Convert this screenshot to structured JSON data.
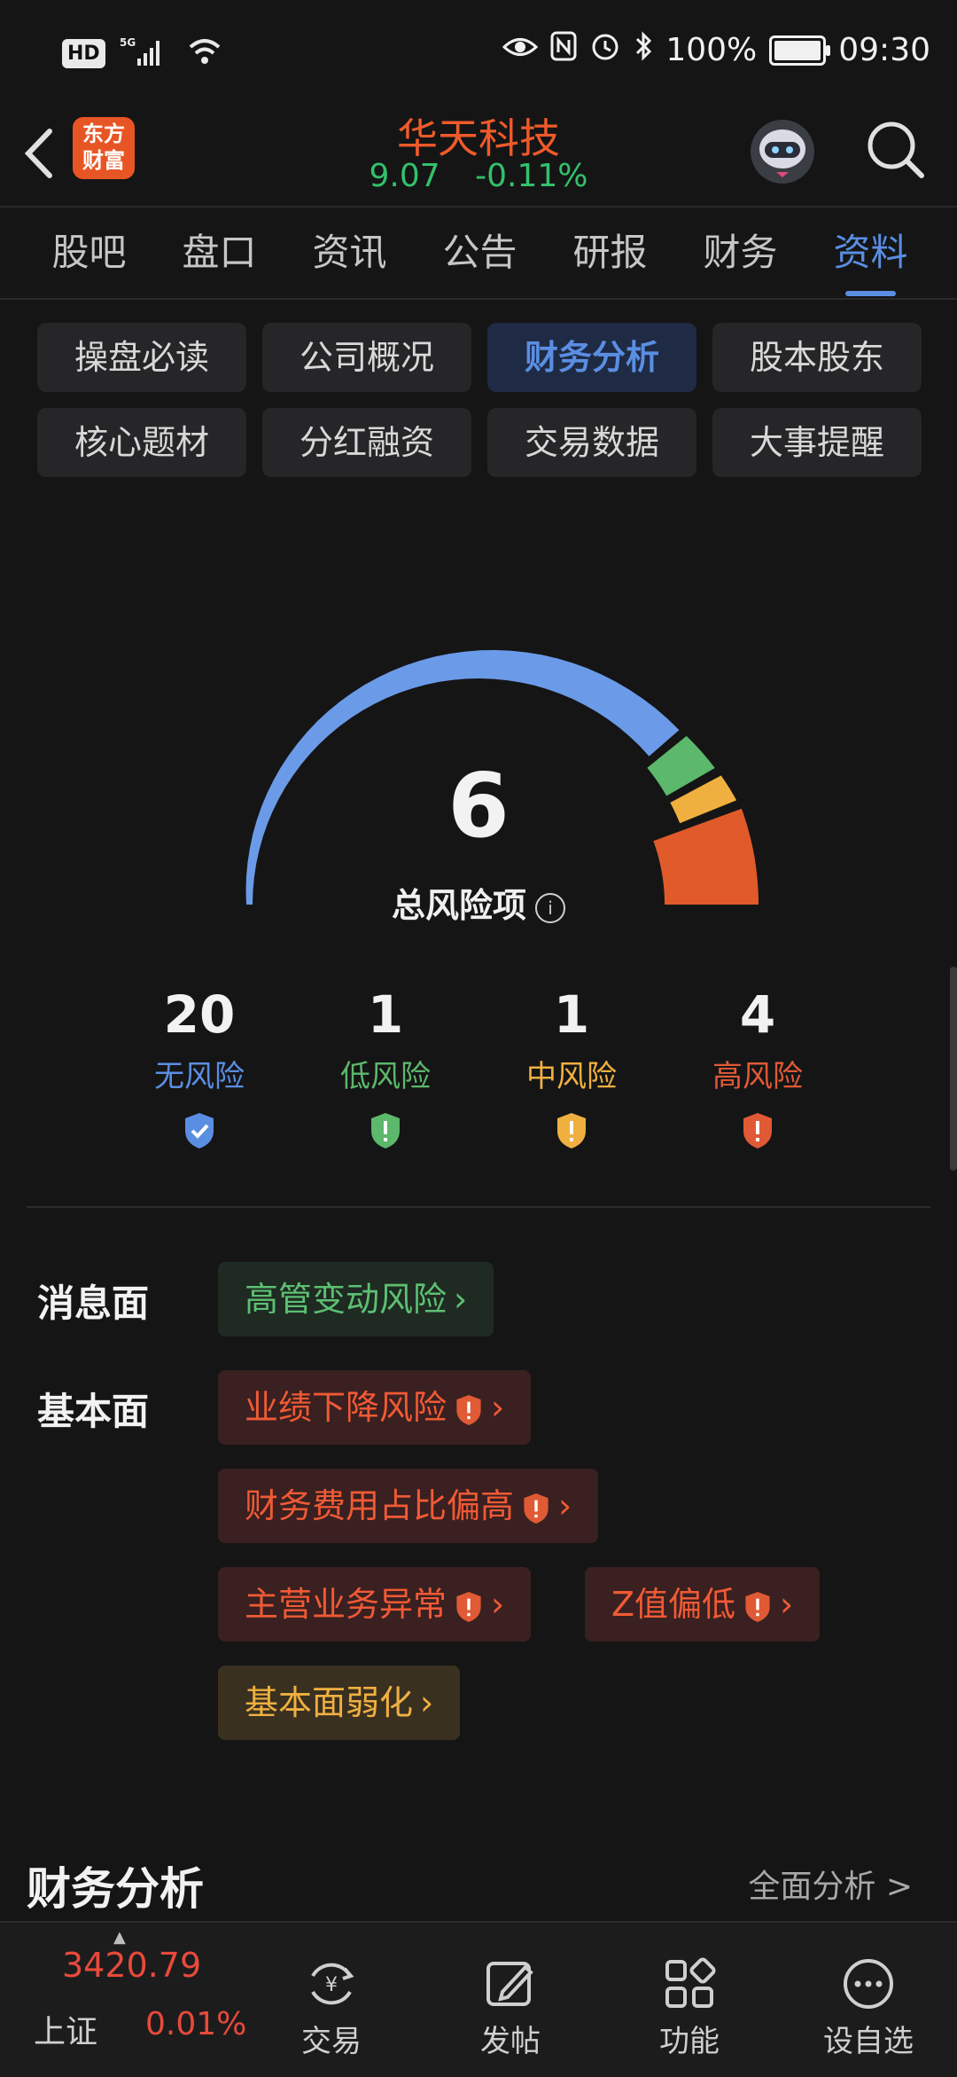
{
  "status_bar": {
    "left_icons": [
      "HD",
      "5G"
    ],
    "battery": "100%",
    "battery_level": 1.0,
    "time": "09:30"
  },
  "header": {
    "logo_text_line1": "东方",
    "logo_text_line2": "财富",
    "stock_name": "华天科技",
    "price": "9.07",
    "change_pct": "-0.11%"
  },
  "tabs": [
    {
      "label": "股吧"
    },
    {
      "label": "盘口"
    },
    {
      "label": "资讯"
    },
    {
      "label": "公告"
    },
    {
      "label": "研报"
    },
    {
      "label": "财务"
    },
    {
      "label": "资料",
      "active": true
    }
  ],
  "chips": [
    {
      "label": "操盘必读"
    },
    {
      "label": "公司概况"
    },
    {
      "label": "财务分析",
      "active": true
    },
    {
      "label": "股本股东"
    },
    {
      "label": "核心题材"
    },
    {
      "label": "分红融资"
    },
    {
      "label": "交易数据"
    },
    {
      "label": "大事提醒"
    }
  ],
  "gauge": {
    "total": "6",
    "label": "总风险项",
    "colors": {
      "none": "#6b9be8",
      "low": "#5cb86a",
      "mid": "#f0b040",
      "high": "#e05a2a"
    }
  },
  "risk_stats": [
    {
      "count": "20",
      "label": "无风险",
      "color": "#5a8ee2"
    },
    {
      "count": "1",
      "label": "低风险",
      "color": "#5cb86a"
    },
    {
      "count": "1",
      "label": "中风险",
      "color": "#f0b040"
    },
    {
      "count": "4",
      "label": "高风险",
      "color": "#e05a35"
    }
  ],
  "sections": {
    "news_label": "消息面",
    "news_tags": [
      {
        "label": "高管变动风险",
        "level": "green"
      }
    ],
    "fundamental_label": "基本面",
    "fundamental_tags": [
      {
        "label": "业绩下降风险",
        "level": "red"
      },
      {
        "label": "财务费用占比偏高",
        "level": "red"
      },
      {
        "label": "主营业务异常",
        "level": "red"
      },
      {
        "label": "Z值偏低",
        "level": "red"
      },
      {
        "label": "基本面弱化",
        "level": "yellow"
      }
    ]
  },
  "financial": {
    "title": "财务分析",
    "more": "全面分析 >"
  },
  "bottom_bar": {
    "index_value": "3420.79",
    "index_name": "上证",
    "index_change": "0.01%",
    "items": [
      {
        "label": "交易",
        "icon": "yuan-cycle-icon"
      },
      {
        "label": "发帖",
        "icon": "edit-icon"
      },
      {
        "label": "功能",
        "icon": "grid-icon"
      },
      {
        "label": "设自选",
        "icon": "more-circle-icon"
      }
    ]
  }
}
